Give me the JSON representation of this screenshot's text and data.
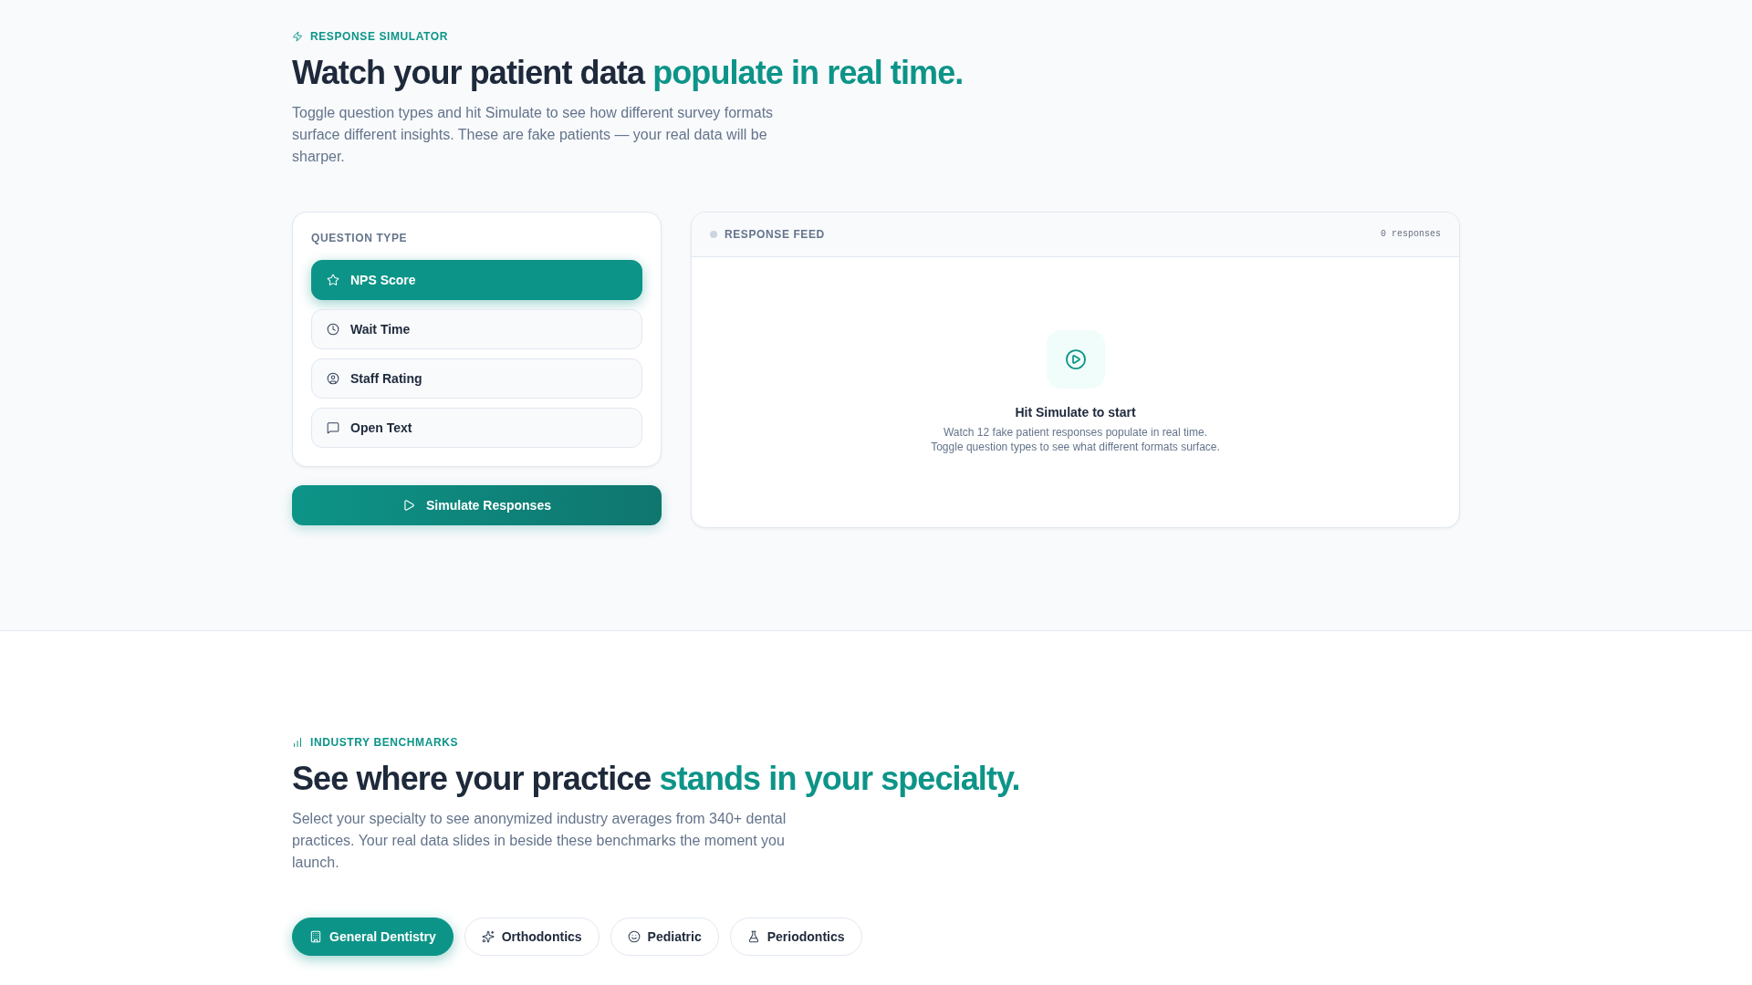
{
  "simulator": {
    "eyebrow": "RESPONSE SIMULATOR",
    "heading": "Watch your patient data",
    "heading_highlight": "populate in real time.",
    "description": "Toggle question types and hit Simulate to see how different survey formats surface different insights. These are fake patients — your real data will be sharper.",
    "question_type": {
      "label": "QUESTION TYPE",
      "options": [
        {
          "kind": "nps",
          "label": "NPS Score",
          "selected": true
        },
        {
          "kind": "wait",
          "label": "Wait Time",
          "selected": false
        },
        {
          "kind": "staff",
          "label": "Staff Rating",
          "selected": false
        },
        {
          "kind": "text",
          "label": "Open Text",
          "selected": false
        }
      ]
    },
    "simulate_button": "Simulate Responses",
    "feed": {
      "title": "RESPONSE FEED",
      "count": "0 responses",
      "empty_title": "Hit Simulate to start",
      "empty_lines": [
        "Watch 12 fake patient responses populate in real time.",
        "Toggle question types to see what different formats surface."
      ]
    }
  },
  "benchmarks": {
    "eyebrow": "INDUSTRY BENCHMARKS",
    "heading": "See where your practice",
    "heading_highlight": "stands in your specialty.",
    "description": "Select your specialty to see anonymized industry averages from 340+ dental practices. Your real data slides in beside these benchmarks the moment you launch.",
    "specialties": [
      {
        "kind": "general",
        "label": "General Dentistry",
        "selected": true
      },
      {
        "kind": "ortho",
        "label": "Orthodontics",
        "selected": false
      },
      {
        "kind": "pediatric",
        "label": "Pediatric",
        "selected": false
      },
      {
        "kind": "perio",
        "label": "Periodontics",
        "selected": false
      }
    ]
  }
}
